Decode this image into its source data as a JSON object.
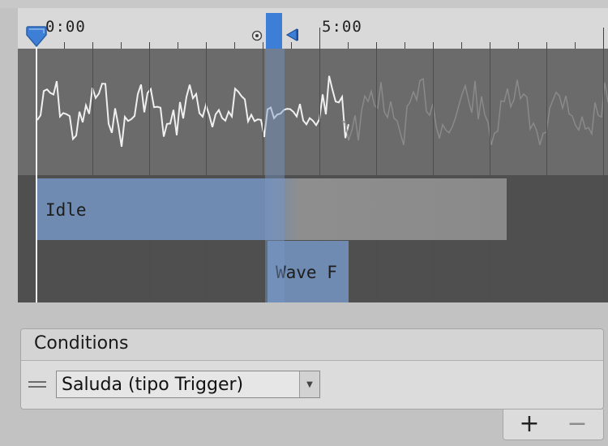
{
  "timeline": {
    "ruler_labels": [
      "0:00",
      "5:00"
    ]
  },
  "states": {
    "source": "Idle",
    "destination": "Wave F"
  },
  "conditions": {
    "title": "Conditions",
    "items": [
      {
        "parameter": "Saluda (tipo Trigger)"
      }
    ],
    "add_label": "+",
    "remove_label": "−"
  },
  "colors": {
    "accent": "#3d7fd6",
    "state_bar_active": "#6f8bb1",
    "state_bar_inactive": "#8a8a8a"
  }
}
